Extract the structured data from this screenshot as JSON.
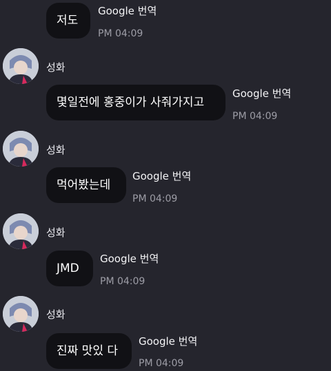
{
  "messages": [
    {
      "sender": "",
      "text": "저도",
      "translate": "Google 번역",
      "time": "PM 04:09"
    },
    {
      "sender": "성화",
      "text": "몇일전에 홍중이가 사줘가지고",
      "translate": "Google 번역",
      "time": "PM 04:09"
    },
    {
      "sender": "성화",
      "text": "먹어봤는데",
      "translate": "Google 번역",
      "time": "PM 04:09"
    },
    {
      "sender": "성화",
      "text": "JMD",
      "translate": "Google 번역",
      "time": "PM 04:09"
    },
    {
      "sender": "성화",
      "text": "진짜 맛있 다",
      "translate": "Google 번역",
      "time": "PM 04:09"
    }
  ],
  "colors": {
    "background": "#25252d",
    "bubble": "#111115",
    "time": "#9d9da6"
  },
  "icons": {
    "avatar": "profile-photo-avatar"
  }
}
